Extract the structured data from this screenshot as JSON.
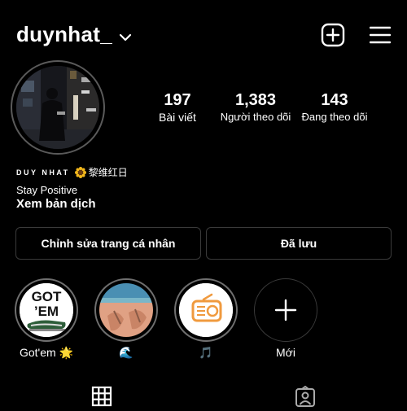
{
  "header": {
    "username": "duynhat_",
    "new_post_icon": "plus-square-icon",
    "menu_icon": "hamburger-menu-icon"
  },
  "profile": {
    "stats": [
      {
        "value": "197",
        "label": "Bài viết"
      },
      {
        "value": "1,383",
        "label": "Người theo dõi"
      },
      {
        "value": "143",
        "label": "Đang theo dõi"
      }
    ],
    "bio": {
      "name_latin": "DUY NHAT",
      "name_emoji": "sunflower",
      "name_cjk": "黎维红日",
      "line": "Stay Positive",
      "translate": "Xem bản dịch"
    }
  },
  "actions": {
    "edit_label": "Chỉnh sửa trang cá nhân",
    "saved_label": "Đã lưu"
  },
  "highlights": [
    {
      "caption": "Got'em 🌟",
      "cover_text": "GOT'EM"
    },
    {
      "caption": "🌊"
    },
    {
      "caption": "🎵"
    },
    {
      "caption": "Mới"
    }
  ],
  "tabs": [
    {
      "name": "posts-grid",
      "icon": "grid-icon",
      "active": true
    },
    {
      "name": "tagged",
      "icon": "tagged-person-icon",
      "active": false
    }
  ],
  "colors": {
    "background": "#000000",
    "text": "#ffffff",
    "border": "#3a3a3a",
    "radio_orange": "#f09a3e"
  }
}
